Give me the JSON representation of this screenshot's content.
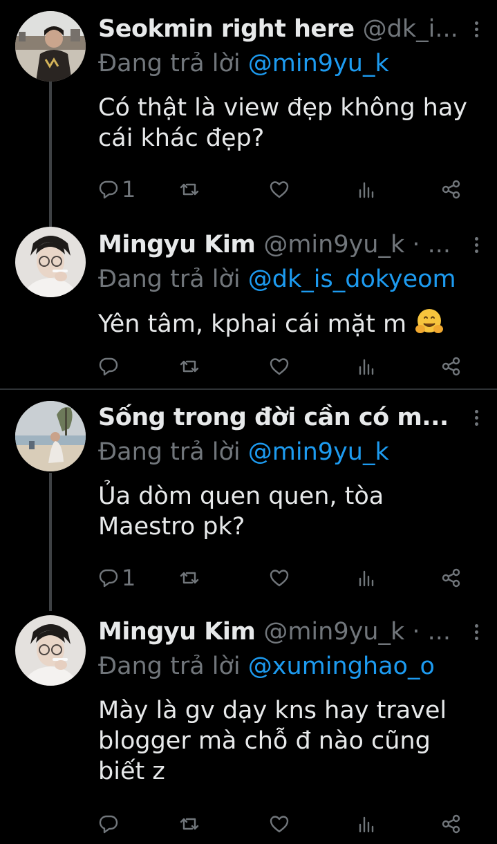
{
  "reply_prefix": "Đang trả lời",
  "tweets": [
    {
      "name": "Seokmin right here",
      "handle": "@dk_i...",
      "reply_to": "@min9yu_k",
      "text": "Có thật là view đẹp không hay cái khác đẹp?",
      "reply_count": "1"
    },
    {
      "name": "Mingyu Kim",
      "handle": "@min9yu_k · ...",
      "reply_to": "@dk_is_dokyeom",
      "text": "Yên tâm, kphai cái mặt m",
      "reply_count": ""
    },
    {
      "name": "Sống trong đời cần có m...",
      "handle": "",
      "reply_to": "@min9yu_k",
      "text": "Ủa dòm quen quen, tòa Maestro pk?",
      "reply_count": "1"
    },
    {
      "name": "Mingyu Kim",
      "handle": "@min9yu_k · ...",
      "reply_to": "@xuminghao_o",
      "text": "Mày là gv dạy kns hay travel blogger mà chỗ đ nào cũng biết z",
      "reply_count": ""
    }
  ],
  "icons": [
    "reply-icon",
    "retweet-icon",
    "like-icon",
    "analytics-icon",
    "share-icon",
    "more-icon",
    "hugging-face-emoji"
  ],
  "colors": {
    "background": "#000000",
    "text": "#e7e9ea",
    "muted": "#71767b",
    "mention": "#1d9bf0",
    "thread_line": "#3e4144",
    "divider": "#2f3336"
  }
}
